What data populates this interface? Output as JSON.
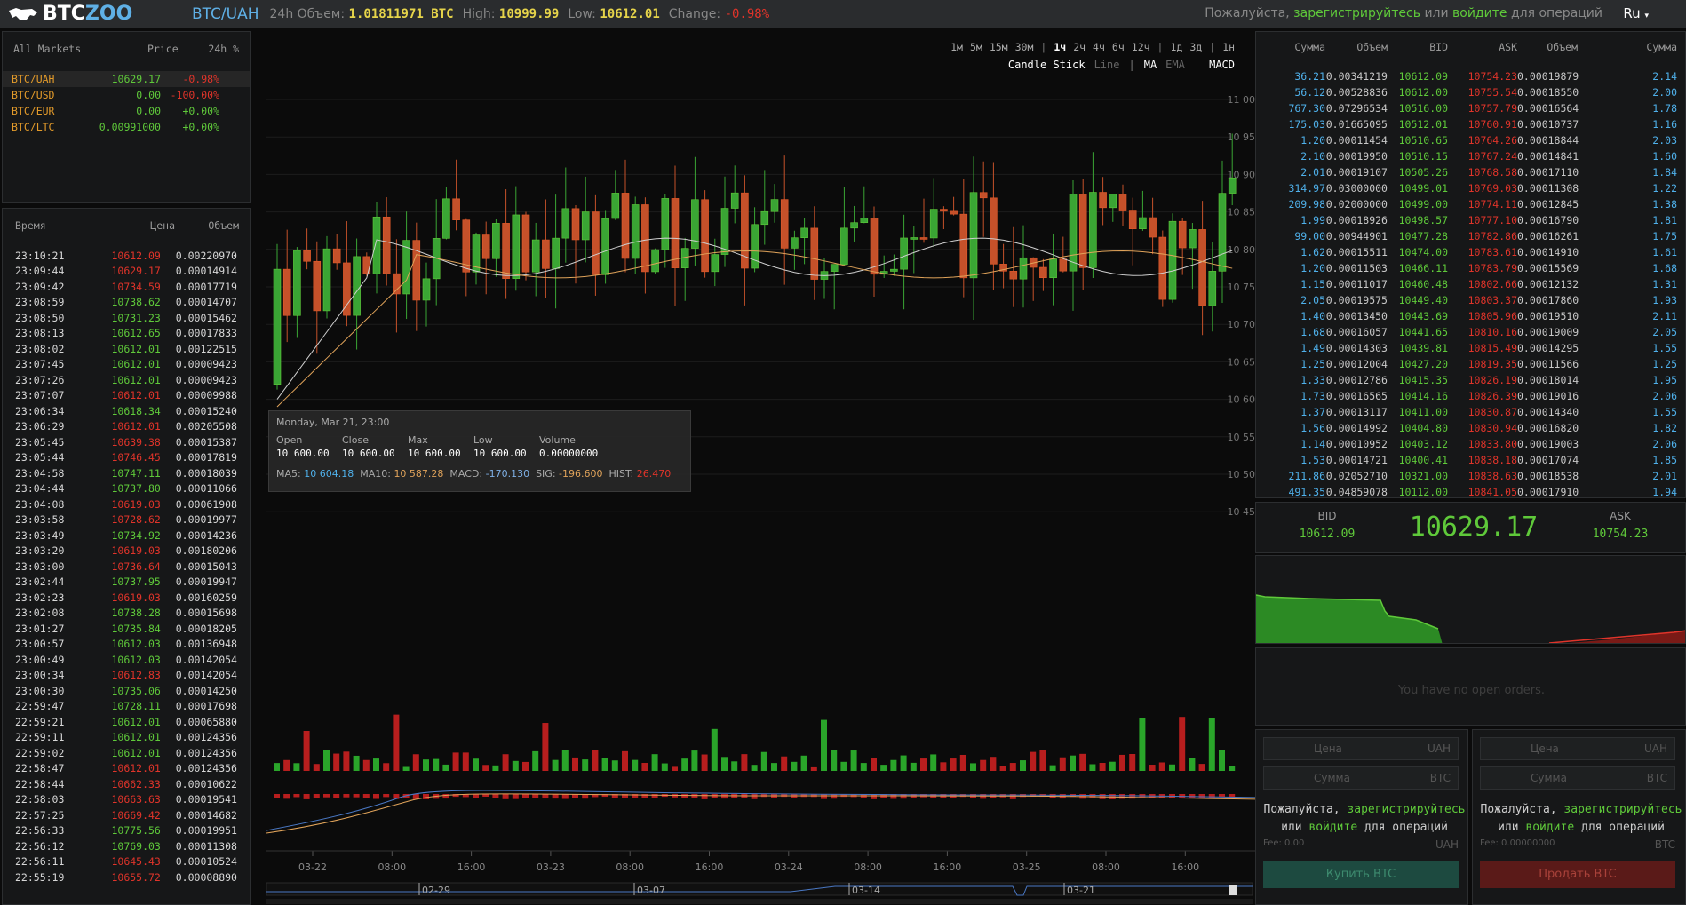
{
  "header": {
    "logo_text_a": "BTC",
    "logo_text_b": "ZOO",
    "pair": "BTC/UAH",
    "volume_label": "24h Объем:",
    "volume_value": "1.01811971 BTC",
    "high_label": "High:",
    "high_value": "10999.99",
    "low_label": "Low:",
    "low_value": "10612.01",
    "change_label": "Change:",
    "change_value": "-0.98%",
    "reg_prefix": "Пожалуйста,",
    "reg_link": "зарегистрируйтесь",
    "reg_or": "или",
    "login_link": "войдите",
    "reg_suffix": "для операций",
    "language": "Ru"
  },
  "markets": {
    "headers": [
      "All Markets",
      "Price",
      "24h %"
    ],
    "rows": [
      {
        "name": "BTC/UAH",
        "price": "10629.17",
        "change": "-0.98%",
        "neg": true
      },
      {
        "name": "BTC/USD",
        "price": "0.00",
        "change": "-100.00%",
        "neg": true
      },
      {
        "name": "BTC/EUR",
        "price": "0.00",
        "change": "+0.00%",
        "neg": false
      },
      {
        "name": "BTC/LTC",
        "price": "0.00991000",
        "change": "+0.00%",
        "neg": false
      }
    ]
  },
  "trades": {
    "headers": [
      "Время",
      "Цена",
      "Объем"
    ],
    "rows": [
      [
        "23:10:21",
        "10612.09",
        "0.00220970",
        "r"
      ],
      [
        "23:09:44",
        "10629.17",
        "0.00014914",
        "r"
      ],
      [
        "23:09:42",
        "10734.59",
        "0.00017719",
        "r"
      ],
      [
        "23:08:59",
        "10738.62",
        "0.00014707",
        "g"
      ],
      [
        "23:08:50",
        "10731.23",
        "0.00015462",
        "g"
      ],
      [
        "23:08:13",
        "10612.65",
        "0.00017833",
        "g"
      ],
      [
        "23:08:02",
        "10612.01",
        "0.00122515",
        "g"
      ],
      [
        "23:07:45",
        "10612.01",
        "0.00009423",
        "g"
      ],
      [
        "23:07:26",
        "10612.01",
        "0.00009423",
        "g"
      ],
      [
        "23:07:07",
        "10612.01",
        "0.00009988",
        "r"
      ],
      [
        "23:06:34",
        "10618.34",
        "0.00015240",
        "g"
      ],
      [
        "23:06:29",
        "10612.01",
        "0.00205508",
        "r"
      ],
      [
        "23:05:45",
        "10639.38",
        "0.00015387",
        "r"
      ],
      [
        "23:05:44",
        "10746.45",
        "0.00017819",
        "r"
      ],
      [
        "23:04:58",
        "10747.11",
        "0.00018039",
        "g"
      ],
      [
        "23:04:44",
        "10737.80",
        "0.00011066",
        "g"
      ],
      [
        "23:04:08",
        "10619.03",
        "0.00061908",
        "r"
      ],
      [
        "23:03:58",
        "10728.62",
        "0.00019977",
        "r"
      ],
      [
        "23:03:49",
        "10734.92",
        "0.00014236",
        "g"
      ],
      [
        "23:03:20",
        "10619.03",
        "0.00180206",
        "r"
      ],
      [
        "23:03:00",
        "10736.64",
        "0.00015043",
        "r"
      ],
      [
        "23:02:44",
        "10737.95",
        "0.00019947",
        "g"
      ],
      [
        "23:02:23",
        "10619.03",
        "0.00160259",
        "r"
      ],
      [
        "23:02:08",
        "10738.28",
        "0.00015698",
        "g"
      ],
      [
        "23:01:27",
        "10735.84",
        "0.00018205",
        "g"
      ],
      [
        "23:00:57",
        "10612.03",
        "0.00136948",
        "g"
      ],
      [
        "23:00:49",
        "10612.03",
        "0.00142054",
        "g"
      ],
      [
        "23:00:34",
        "10612.83",
        "0.00142054",
        "r"
      ],
      [
        "23:00:30",
        "10735.06",
        "0.00014250",
        "g"
      ],
      [
        "22:59:47",
        "10728.11",
        "0.00017698",
        "g"
      ],
      [
        "22:59:21",
        "10612.01",
        "0.00065880",
        "g"
      ],
      [
        "22:59:11",
        "10612.01",
        "0.00124356",
        "g"
      ],
      [
        "22:59:02",
        "10612.01",
        "0.00124356",
        "g"
      ],
      [
        "22:58:47",
        "10612.01",
        "0.00124356",
        "r"
      ],
      [
        "22:58:44",
        "10662.33",
        "0.00010622",
        "r"
      ],
      [
        "22:58:03",
        "10663.63",
        "0.00019541",
        "r"
      ],
      [
        "22:57:25",
        "10669.42",
        "0.00014682",
        "r"
      ],
      [
        "22:56:33",
        "10775.56",
        "0.00019951",
        "g"
      ],
      [
        "22:56:12",
        "10769.03",
        "0.00011308",
        "g"
      ],
      [
        "22:56:11",
        "10645.43",
        "0.00010524",
        "r"
      ],
      [
        "22:55:19",
        "10655.72",
        "0.00008890",
        "r"
      ]
    ]
  },
  "chart": {
    "ranges": [
      "1м",
      "5м",
      "15м",
      "30м",
      "|",
      "1ч",
      "2ч",
      "4ч",
      "6ч",
      "12ч",
      "|",
      "1д",
      "3д",
      "|",
      "1н"
    ],
    "selected_range": "1ч",
    "types": [
      "Candle Stick",
      "Line",
      "|",
      "MA",
      "EMA",
      "|",
      "MACD"
    ],
    "y_ticks": [
      "11 000",
      "10 950",
      "10 900",
      "10 850",
      "10 800",
      "10 750",
      "10 700",
      "10 650",
      "10 600",
      "10 550",
      "10 500",
      "10 450"
    ],
    "x_ticks": [
      "03-22",
      "08:00",
      "16:00",
      "03-23",
      "08:00",
      "16:00",
      "03-24",
      "08:00",
      "16:00",
      "03-25",
      "08:00",
      "16:00"
    ],
    "nav_ticks": [
      "02-29",
      "03-07",
      "03-14",
      "03-21"
    ],
    "tooltip": {
      "date": "Monday, Mar 21, 23:00",
      "open_label": "Open",
      "close_label": "Close",
      "max_label": "Max",
      "low_label": "Low",
      "volume_label": "Volume",
      "open": "10 600.00",
      "close": "10 600.00",
      "max": "10 600.00",
      "low": "10 600.00",
      "volume": "0.00000000",
      "ma5_label": "MA5:",
      "ma5": "10 604.18",
      "ma10_label": "MA10:",
      "ma10": "10 587.28",
      "macd_label": "MACD:",
      "macd": "-170.130",
      "sig_label": "SIG:",
      "sig": "-196.600",
      "hist_label": "HIST:",
      "hist": "26.470"
    }
  },
  "chart_data": {
    "type": "candlestick",
    "ylim": [
      10450,
      11000
    ],
    "note_ranges": "hourly candles 03-21 23:00 to 03-25 ~23:00",
    "colors": {
      "up": "#3aa534",
      "down": "#c5512a",
      "ma5": "#c9c9c9",
      "ma10": "#e0a35a",
      "macd": "#4a78c4"
    }
  },
  "orderbook": {
    "headers": [
      "Сумма",
      "Объем",
      "BID",
      "ASK",
      "Объем",
      "Сумма"
    ],
    "rows": [
      [
        "36.21",
        "0.00341219",
        "10612.09",
        "10754.23",
        "0.00019879",
        "2.14"
      ],
      [
        "56.12",
        "0.00528836",
        "10612.00",
        "10755.54",
        "0.00018550",
        "2.00"
      ],
      [
        "767.30",
        "0.07296534",
        "10516.00",
        "10757.79",
        "0.00016564",
        "1.78"
      ],
      [
        "175.03",
        "0.01665095",
        "10512.01",
        "10760.91",
        "0.00010737",
        "1.16"
      ],
      [
        "1.20",
        "0.00011454",
        "10510.65",
        "10764.26",
        "0.00018844",
        "2.03"
      ],
      [
        "2.10",
        "0.00019950",
        "10510.15",
        "10767.24",
        "0.00014841",
        "1.60"
      ],
      [
        "2.01",
        "0.00019107",
        "10505.26",
        "10768.58",
        "0.00017110",
        "1.84"
      ],
      [
        "314.97",
        "0.03000000",
        "10499.01",
        "10769.03",
        "0.00011308",
        "1.22"
      ],
      [
        "209.98",
        "0.02000000",
        "10499.00",
        "10774.11",
        "0.00012845",
        "1.38"
      ],
      [
        "1.99",
        "0.00018926",
        "10498.57",
        "10777.10",
        "0.00016790",
        "1.81"
      ],
      [
        "99.00",
        "0.00944901",
        "10477.28",
        "10782.86",
        "0.00016261",
        "1.75"
      ],
      [
        "1.62",
        "0.00015511",
        "10474.00",
        "10783.61",
        "0.00014910",
        "1.61"
      ],
      [
        "1.20",
        "0.00011503",
        "10466.11",
        "10783.79",
        "0.00015569",
        "1.68"
      ],
      [
        "1.15",
        "0.00011017",
        "10460.48",
        "10802.66",
        "0.00012132",
        "1.31"
      ],
      [
        "2.05",
        "0.00019575",
        "10449.40",
        "10803.37",
        "0.00017860",
        "1.93"
      ],
      [
        "1.40",
        "0.00013450",
        "10443.69",
        "10805.96",
        "0.00019510",
        "2.11"
      ],
      [
        "1.68",
        "0.00016057",
        "10441.65",
        "10810.16",
        "0.00019009",
        "2.05"
      ],
      [
        "1.49",
        "0.00014303",
        "10439.81",
        "10815.49",
        "0.00014295",
        "1.55"
      ],
      [
        "1.25",
        "0.00012004",
        "10427.20",
        "10819.35",
        "0.00011566",
        "1.25"
      ],
      [
        "1.33",
        "0.00012786",
        "10415.35",
        "10826.19",
        "0.00018014",
        "1.95"
      ],
      [
        "1.73",
        "0.00016565",
        "10414.16",
        "10826.39",
        "0.00019016",
        "2.06"
      ],
      [
        "1.37",
        "0.00013117",
        "10411.00",
        "10830.87",
        "0.00014340",
        "1.55"
      ],
      [
        "1.56",
        "0.00014992",
        "10404.80",
        "10830.94",
        "0.00016820",
        "1.82"
      ],
      [
        "1.14",
        "0.00010952",
        "10403.12",
        "10833.80",
        "0.00019003",
        "2.06"
      ],
      [
        "1.53",
        "0.00014721",
        "10400.41",
        "10838.18",
        "0.00017074",
        "1.85"
      ],
      [
        "211.86",
        "0.02052710",
        "10321.00",
        "10838.63",
        "0.00018538",
        "2.01"
      ],
      [
        "491.35",
        "0.04859078",
        "10112.00",
        "10841.05",
        "0.00017910",
        "1.94"
      ]
    ]
  },
  "ticker": {
    "bid_label": "BID",
    "bid": "10612.09",
    "last": "10629.17",
    "ask_label": "ASK",
    "ask": "10754.23"
  },
  "open_orders": {
    "empty_text": "You have no open orders."
  },
  "buy_form": {
    "price_placeholder": "Цена",
    "price_unit": "UAH",
    "amount_placeholder": "Сумма",
    "amount_unit": "BTC",
    "msg_a": "Пожалуйста,",
    "msg_reg": "зарегистрируйтесь",
    "msg_or": "или",
    "msg_login": "войдите",
    "msg_b": "для операций",
    "fee": "Fee: 0.00",
    "fee_unit": "UAH",
    "button": "Купить BTC"
  },
  "sell_form": {
    "price_placeholder": "Цена",
    "price_unit": "UAH",
    "amount_placeholder": "Сумма",
    "amount_unit": "BTC",
    "msg_a": "Пожалуйста,",
    "msg_reg": "зарегистрируйтесь",
    "msg_or": "или",
    "msg_login": "войдите",
    "msg_b": "для операций",
    "fee": "Fee: 0.00000000",
    "fee_unit": "BTC",
    "button": "Продать BTC"
  }
}
